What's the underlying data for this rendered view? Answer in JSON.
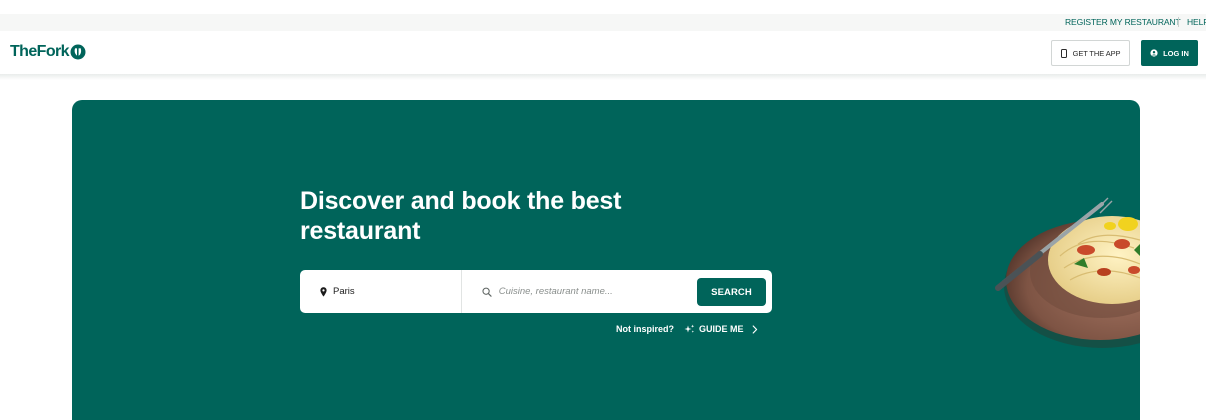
{
  "utility": {
    "register_label": "REGISTER MY RESTAURANT",
    "help_label": "HELP"
  },
  "header": {
    "logo_text": "TheFork",
    "get_app_label": "GET THE APP",
    "login_label": "LOG IN"
  },
  "hero": {
    "title": "Discover and book the best restaurant",
    "search": {
      "location_value": "Paris",
      "query_placeholder": "Cuisine, restaurant name...",
      "search_label": "SEARCH"
    },
    "inspire_text": "Not inspired?",
    "guide_label": "GUIDE ME"
  },
  "colors": {
    "brand_green": "#00645a",
    "background": "#ffffff"
  },
  "icons": [
    "fork-logo-icon",
    "phone-icon",
    "user-icon",
    "location-pin-icon",
    "search-icon",
    "sparkle-icon",
    "chevron-right-icon"
  ]
}
